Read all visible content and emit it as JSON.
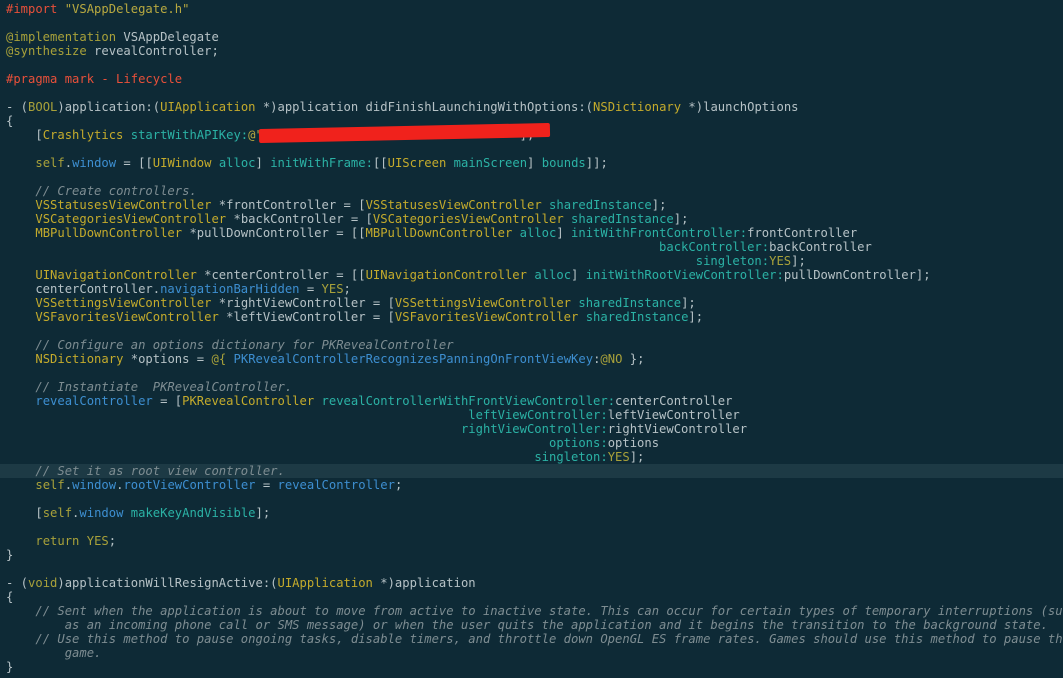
{
  "editor": {
    "background": "#0e2a36",
    "current_line_index": 33,
    "colors": {
      "preprocessor": "#e8503a",
      "string": "#b8a940",
      "keyword": "#a8a13a",
      "class": "#c4ab2c",
      "method": "#2bb2a5",
      "ivar": "#3d8fd1",
      "comment": "#7e8d92",
      "plain": "#b6c2c6"
    },
    "lines": [
      [
        [
          "pp",
          "#import "
        ],
        [
          "str",
          "\"VSAppDelegate.h\""
        ]
      ],
      [],
      [
        [
          "kw",
          "@implementation"
        ],
        [
          "plain",
          " VSAppDelegate"
        ]
      ],
      [
        [
          "kw",
          "@synthesize"
        ],
        [
          "plain",
          " revealController;"
        ]
      ],
      [],
      [
        [
          "pp",
          "#pragma mark - Lifecycle"
        ]
      ],
      [],
      [
        [
          "plain",
          "- ("
        ],
        [
          "kw",
          "BOOL"
        ],
        [
          "plain",
          ")application:("
        ],
        [
          "cls",
          "UIApplication"
        ],
        [
          "plain",
          " *)application didFinishLaunchingWithOptions:("
        ],
        [
          "cls",
          "NSDictionary"
        ],
        [
          "plain",
          " *)launchOptions"
        ]
      ],
      [
        [
          "plain",
          "{"
        ]
      ],
      [
        [
          "plain",
          "    ["
        ],
        [
          "cls",
          "Crashlytics"
        ],
        [
          "plain",
          " "
        ],
        [
          "meth",
          "startWithAPIKey:"
        ],
        [
          "str",
          "@\""
        ],
        [
          "redact",
          ""
        ],
        [
          "str",
          "                                  \""
        ],
        [
          "plain",
          "];"
        ]
      ],
      [],
      [
        [
          "plain",
          "    "
        ],
        [
          "kw",
          "self"
        ],
        [
          "plain",
          "."
        ],
        [
          "ivar",
          "window"
        ],
        [
          "plain",
          " = [["
        ],
        [
          "cls",
          "UIWindow"
        ],
        [
          "plain",
          " "
        ],
        [
          "meth",
          "alloc"
        ],
        [
          "plain",
          "] "
        ],
        [
          "meth",
          "initWithFrame:"
        ],
        [
          "plain",
          "[["
        ],
        [
          "cls",
          "UIScreen"
        ],
        [
          "plain",
          " "
        ],
        [
          "meth",
          "mainScreen"
        ],
        [
          "plain",
          "] "
        ],
        [
          "meth",
          "bounds"
        ],
        [
          "plain",
          "]];"
        ]
      ],
      [],
      [
        [
          "plain",
          "    "
        ],
        [
          "cmt",
          "// Create controllers."
        ]
      ],
      [
        [
          "plain",
          "    "
        ],
        [
          "cls",
          "VSStatusesViewController"
        ],
        [
          "plain",
          " *frontController = ["
        ],
        [
          "cls",
          "VSStatusesViewController"
        ],
        [
          "plain",
          " "
        ],
        [
          "meth",
          "sharedInstance"
        ],
        [
          "plain",
          "];"
        ]
      ],
      [
        [
          "plain",
          "    "
        ],
        [
          "cls",
          "VSCategoriesViewController"
        ],
        [
          "plain",
          " *backController = ["
        ],
        [
          "cls",
          "VSCategoriesViewController"
        ],
        [
          "plain",
          " "
        ],
        [
          "meth",
          "sharedInstance"
        ],
        [
          "plain",
          "];"
        ]
      ],
      [
        [
          "plain",
          "    "
        ],
        [
          "cls",
          "MBPullDownController"
        ],
        [
          "plain",
          " *pullDownController = [["
        ],
        [
          "cls",
          "MBPullDownController"
        ],
        [
          "plain",
          " "
        ],
        [
          "meth",
          "alloc"
        ],
        [
          "plain",
          "] "
        ],
        [
          "meth",
          "initWithFrontController:"
        ],
        [
          "plain",
          "frontController"
        ]
      ],
      [
        [
          "plain",
          "                                                                                         "
        ],
        [
          "meth",
          "backController:"
        ],
        [
          "plain",
          "backController"
        ]
      ],
      [
        [
          "plain",
          "                                                                                              "
        ],
        [
          "meth",
          "singleton:"
        ],
        [
          "kw",
          "YES"
        ],
        [
          "plain",
          "];"
        ]
      ],
      [
        [
          "plain",
          "    "
        ],
        [
          "cls",
          "UINavigationController"
        ],
        [
          "plain",
          " *centerController = [["
        ],
        [
          "cls",
          "UINavigationController"
        ],
        [
          "plain",
          " "
        ],
        [
          "meth",
          "alloc"
        ],
        [
          "plain",
          "] "
        ],
        [
          "meth",
          "initWithRootViewController:"
        ],
        [
          "plain",
          "pullDownController];"
        ]
      ],
      [
        [
          "plain",
          "    centerController."
        ],
        [
          "ivar",
          "navigationBarHidden"
        ],
        [
          "plain",
          " = "
        ],
        [
          "kw",
          "YES"
        ],
        [
          "plain",
          ";"
        ]
      ],
      [
        [
          "plain",
          "    "
        ],
        [
          "cls",
          "VSSettingsViewController"
        ],
        [
          "plain",
          " *rightViewController = ["
        ],
        [
          "cls",
          "VSSettingsViewController"
        ],
        [
          "plain",
          " "
        ],
        [
          "meth",
          "sharedInstance"
        ],
        [
          "plain",
          "];"
        ]
      ],
      [
        [
          "plain",
          "    "
        ],
        [
          "cls",
          "VSFavoritesViewController"
        ],
        [
          "plain",
          " *leftViewController = ["
        ],
        [
          "cls",
          "VSFavoritesViewController"
        ],
        [
          "plain",
          " "
        ],
        [
          "meth",
          "sharedInstance"
        ],
        [
          "plain",
          "];"
        ]
      ],
      [],
      [
        [
          "plain",
          "    "
        ],
        [
          "cmt",
          "// Configure an options dictionary for PKRevealController"
        ]
      ],
      [
        [
          "plain",
          "    "
        ],
        [
          "cls",
          "NSDictionary"
        ],
        [
          "plain",
          " *options = "
        ],
        [
          "kw",
          "@{"
        ],
        [
          "plain",
          " "
        ],
        [
          "ivar",
          "PKRevealControllerRecognizesPanningOnFrontViewKey"
        ],
        [
          "plain",
          ":"
        ],
        [
          "kw",
          "@NO"
        ],
        [
          "plain",
          " };"
        ]
      ],
      [],
      [
        [
          "plain",
          "    "
        ],
        [
          "cmt",
          "// Instantiate  PKRevealController."
        ]
      ],
      [
        [
          "plain",
          "    "
        ],
        [
          "ivar",
          "revealController"
        ],
        [
          "plain",
          " = ["
        ],
        [
          "cls",
          "PKRevealController"
        ],
        [
          "plain",
          " "
        ],
        [
          "meth",
          "revealControllerWithFrontViewController:"
        ],
        [
          "plain",
          "centerController"
        ]
      ],
      [
        [
          "plain",
          "                                                               "
        ],
        [
          "meth",
          "leftViewController:"
        ],
        [
          "plain",
          "leftViewController"
        ]
      ],
      [
        [
          "plain",
          "                                                              "
        ],
        [
          "meth",
          "rightViewController:"
        ],
        [
          "plain",
          "rightViewController"
        ]
      ],
      [
        [
          "plain",
          "                                                                          "
        ],
        [
          "meth",
          "options:"
        ],
        [
          "plain",
          "options"
        ]
      ],
      [
        [
          "plain",
          "                                                                        "
        ],
        [
          "meth",
          "singleton:"
        ],
        [
          "kw",
          "YES"
        ],
        [
          "plain",
          "];"
        ]
      ],
      [
        [
          "plain",
          "    "
        ],
        [
          "cmt",
          "// Set it as root view controller."
        ]
      ],
      [
        [
          "plain",
          "    "
        ],
        [
          "kw",
          "self"
        ],
        [
          "plain",
          "."
        ],
        [
          "ivar",
          "window"
        ],
        [
          "plain",
          "."
        ],
        [
          "ivar",
          "rootViewController"
        ],
        [
          "plain",
          " = "
        ],
        [
          "ivar",
          "revealController"
        ],
        [
          "plain",
          ";"
        ]
      ],
      [],
      [
        [
          "plain",
          "    ["
        ],
        [
          "kw",
          "self"
        ],
        [
          "plain",
          "."
        ],
        [
          "ivar",
          "window"
        ],
        [
          "plain",
          " "
        ],
        [
          "meth",
          "makeKeyAndVisible"
        ],
        [
          "plain",
          "];"
        ]
      ],
      [],
      [
        [
          "plain",
          "    "
        ],
        [
          "kw",
          "return"
        ],
        [
          "plain",
          " "
        ],
        [
          "kw",
          "YES"
        ],
        [
          "plain",
          ";"
        ]
      ],
      [
        [
          "plain",
          "}"
        ]
      ],
      [],
      [
        [
          "plain",
          "- ("
        ],
        [
          "kw",
          "void"
        ],
        [
          "plain",
          ")applicationWillResignActive:("
        ],
        [
          "cls",
          "UIApplication"
        ],
        [
          "plain",
          " *)application"
        ]
      ],
      [
        [
          "plain",
          "{"
        ]
      ],
      [
        [
          "plain",
          "    "
        ],
        [
          "cmt",
          "// Sent when the application is about to move from active to inactive state. This can occur for certain types of temporary interruptions (such"
        ]
      ],
      [
        [
          "plain",
          "        "
        ],
        [
          "cmt",
          "as an incoming phone call or SMS message) or when the user quits the application and it begins the transition to the background state."
        ]
      ],
      [
        [
          "plain",
          "    "
        ],
        [
          "cmt",
          "// Use this method to pause ongoing tasks, disable timers, and throttle down OpenGL ES frame rates. Games should use this method to pause the"
        ]
      ],
      [
        [
          "plain",
          "        "
        ],
        [
          "cmt",
          "game."
        ]
      ],
      [
        [
          "plain",
          "}"
        ]
      ]
    ]
  }
}
